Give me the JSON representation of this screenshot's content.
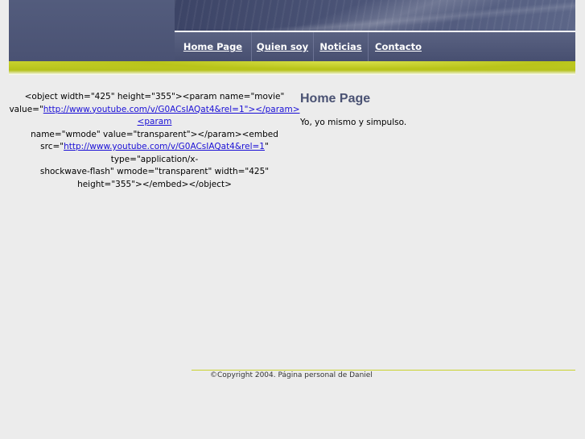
{
  "nav": {
    "items": [
      {
        "label": "Home Page"
      },
      {
        "label": "Quien soy"
      },
      {
        "label": "Noticias"
      },
      {
        "label": "Contacto"
      }
    ]
  },
  "left": {
    "line1": "<object width=\"425\" height=\"355\"><param name=\"movie\"",
    "line2_prefix": "value=\"",
    "line2_link": "http://www.youtube.com/v/G0ACsIAQat4&rel=1\"></param><param",
    "line3": "name=\"wmode\" value=\"transparent\"></param><embed",
    "line4_prefix": "src=\"",
    "line4_link": "http://www.youtube.com/v/G0ACsIAQat4&rel=1",
    "line4_suffix": "\" type=\"application/x-",
    "line5": "shockwave-flash\" wmode=\"transparent\" width=\"425\"",
    "line6": "height=\"355\"></embed></object>"
  },
  "content": {
    "title": "Home Page",
    "text": "Yo, yo mismo y simpulso."
  },
  "footer": {
    "copyright": "©Copyright 2004. Página personal de Daniel"
  },
  "colors": {
    "nav_bg": "#4a5273",
    "accent_lime": "#b9c41a",
    "title": "#4a5273",
    "link": "#1a0fd6"
  }
}
